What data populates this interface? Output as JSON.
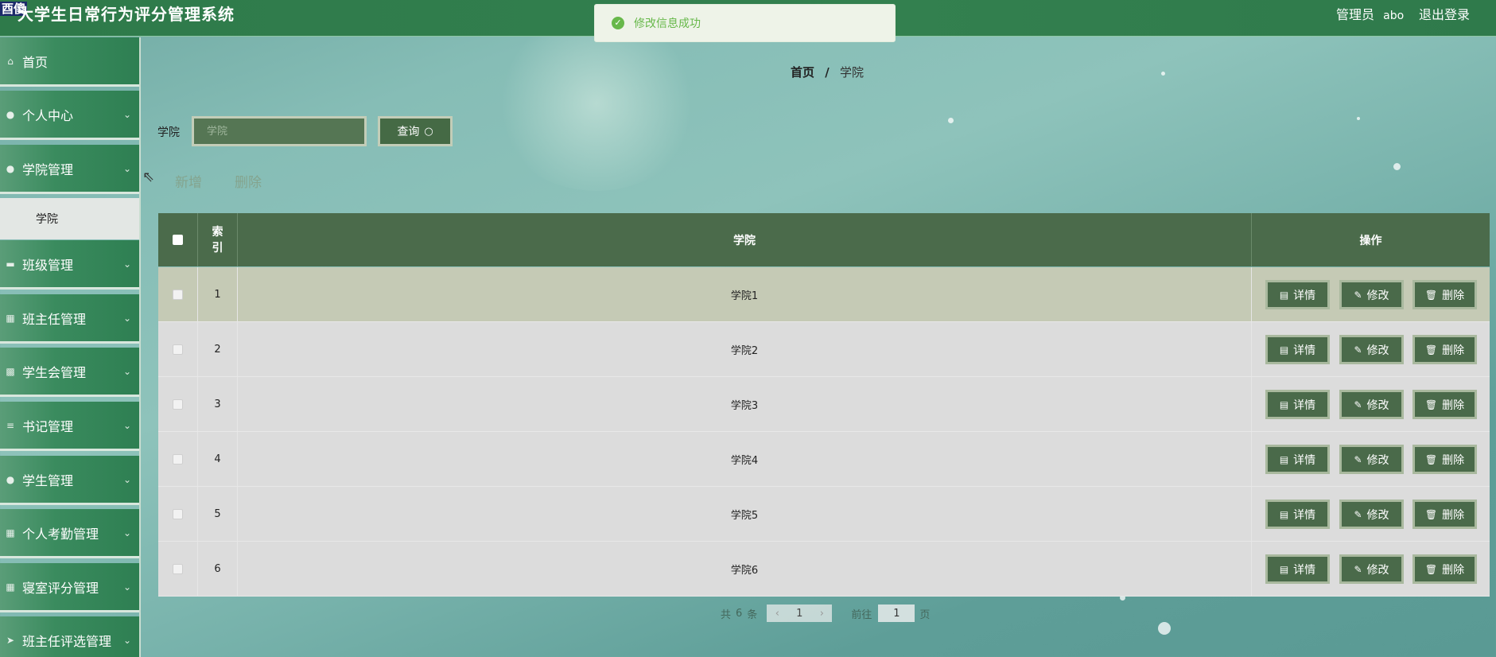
{
  "app": {
    "logo_tag": "酉傻",
    "title": "大学生日常行为评分管理系统",
    "user_role": "管理员",
    "username": "abo",
    "logout_label": "退出登录"
  },
  "toast": {
    "message": "修改信息成功",
    "color": "#67b84a"
  },
  "sidebar": {
    "items": [
      {
        "label": "首页",
        "icon": "home-icon"
      },
      {
        "label": "个人中心",
        "icon": "user-icon"
      },
      {
        "label": "学院管理",
        "icon": "user-icon"
      },
      {
        "label": "班级管理",
        "icon": "chat-icon"
      },
      {
        "label": "班主任管理",
        "icon": "grid-icon"
      },
      {
        "label": "学生会管理",
        "icon": "picture-icon"
      },
      {
        "label": "书记管理",
        "icon": "list-icon"
      },
      {
        "label": "学生管理",
        "icon": "user-icon"
      },
      {
        "label": "个人考勤管理",
        "icon": "grid-icon"
      },
      {
        "label": "寝室评分管理",
        "icon": "grid-icon"
      },
      {
        "label": "班主任评选管理",
        "icon": "send-icon"
      }
    ],
    "submenu_label": "学院"
  },
  "breadcrumb": {
    "home": "首页",
    "separator": "/",
    "current": "学院"
  },
  "search": {
    "label": "学院",
    "placeholder": "学院",
    "button_label": "查询"
  },
  "toolbar": {
    "add_label": "新增",
    "delete_label": "删除"
  },
  "table": {
    "headers": {
      "index": "索\n引",
      "college": "学院",
      "actions": "操作"
    },
    "rows": [
      {
        "index": "1",
        "college": "学院1"
      },
      {
        "index": "2",
        "college": "学院2"
      },
      {
        "index": "3",
        "college": "学院3"
      },
      {
        "index": "4",
        "college": "学院4"
      },
      {
        "index": "5",
        "college": "学院5"
      },
      {
        "index": "6",
        "college": "学院6"
      }
    ],
    "action_labels": {
      "detail": "详情",
      "edit": "修改",
      "delete": "删除"
    }
  },
  "pagination": {
    "total_prefix": "共",
    "total": "6",
    "total_suffix": "条",
    "current_page": "1",
    "goto_prefix": "前往",
    "goto_value": "1",
    "goto_suffix": "页"
  },
  "colors": {
    "header_green": "#33804f",
    "table_header": "#4b6b4b",
    "action_button": "#4a6a4a",
    "success": "#67b84a"
  }
}
